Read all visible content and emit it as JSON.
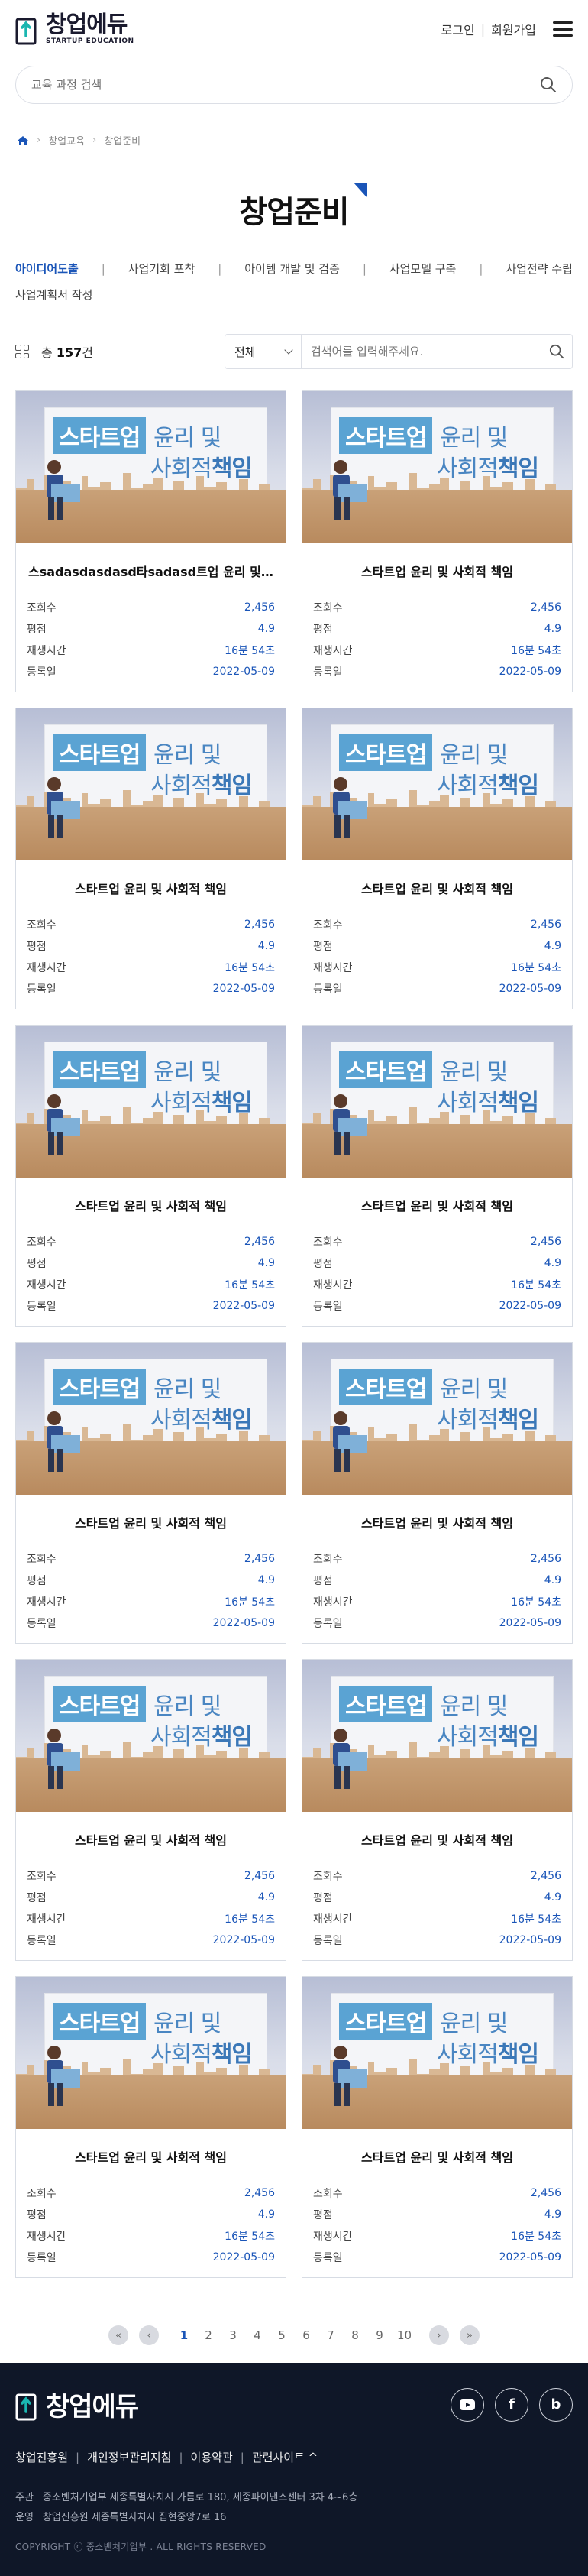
{
  "header": {
    "logo_title": "창업에듀",
    "logo_sub": "STARTUP EDUCATION",
    "login": "로그인",
    "signup": "회원가입"
  },
  "search": {
    "placeholder": "교육 과정 검색"
  },
  "breadcrumb": [
    "창업교육",
    "창업준비"
  ],
  "page_title": "창업준비",
  "categories": [
    "아이디어도출",
    "사업기회 포착",
    "아이템 개발 및 검증",
    "사업모델 구축",
    "사업전략 수립",
    "사업계획서 작성"
  ],
  "active_category": "아이디어도출",
  "filter": {
    "total_prefix": "총",
    "total_count": "157",
    "total_suffix": "건",
    "select_value": "전체",
    "input_placeholder": "검색어를 입력해주세요."
  },
  "meta_labels": {
    "views": "조회수",
    "rating": "평점",
    "duration": "재생시간",
    "date": "등록일"
  },
  "thumb_text": {
    "line1": "스타트업",
    "line2": "윤리 및",
    "line3a": "사회적",
    "line3b": "책임"
  },
  "cards": [
    {
      "title": "스sadasdasdasd타sadasd트업 윤리 및 사회적 책임",
      "views": "2,456",
      "rating": "4.9",
      "duration": "16분 54초",
      "date": "2022-05-09"
    },
    {
      "title": "스타트업 윤리 및 사회적 책임",
      "views": "2,456",
      "rating": "4.9",
      "duration": "16분 54초",
      "date": "2022-05-09"
    },
    {
      "title": "스타트업 윤리 및 사회적 책임",
      "views": "2,456",
      "rating": "4.9",
      "duration": "16분 54초",
      "date": "2022-05-09"
    },
    {
      "title": "스타트업 윤리 및 사회적 책임",
      "views": "2,456",
      "rating": "4.9",
      "duration": "16분 54초",
      "date": "2022-05-09"
    },
    {
      "title": "스타트업 윤리 및 사회적 책임",
      "views": "2,456",
      "rating": "4.9",
      "duration": "16분 54초",
      "date": "2022-05-09"
    },
    {
      "title": "스타트업 윤리 및 사회적 책임",
      "views": "2,456",
      "rating": "4.9",
      "duration": "16분 54초",
      "date": "2022-05-09"
    },
    {
      "title": "스타트업 윤리 및 사회적 책임",
      "views": "2,456",
      "rating": "4.9",
      "duration": "16분 54초",
      "date": "2022-05-09"
    },
    {
      "title": "스타트업 윤리 및 사회적 책임",
      "views": "2,456",
      "rating": "4.9",
      "duration": "16분 54초",
      "date": "2022-05-09"
    },
    {
      "title": "스타트업 윤리 및 사회적 책임",
      "views": "2,456",
      "rating": "4.9",
      "duration": "16분 54초",
      "date": "2022-05-09"
    },
    {
      "title": "스타트업 윤리 및 사회적 책임",
      "views": "2,456",
      "rating": "4.9",
      "duration": "16분 54초",
      "date": "2022-05-09"
    },
    {
      "title": "스타트업 윤리 및 사회적 책임",
      "views": "2,456",
      "rating": "4.9",
      "duration": "16분 54초",
      "date": "2022-05-09"
    },
    {
      "title": "스타트업 윤리 및 사회적 책임",
      "views": "2,456",
      "rating": "4.9",
      "duration": "16분 54초",
      "date": "2022-05-09"
    }
  ],
  "pagination": {
    "pages": [
      "1",
      "2",
      "3",
      "4",
      "5",
      "6",
      "7",
      "8",
      "9",
      "10"
    ],
    "current": "1"
  },
  "footer": {
    "logo_title": "창업에듀",
    "links": [
      "창업진흥원",
      "개인정보관리지침",
      "이용약관",
      "관련사이트 ^"
    ],
    "host_label": "주관",
    "host_value": "중소벤처기업부   세종특별자치시 가름로 180, 세종파이낸스센터 3차 4~6층",
    "operator_label": "운영",
    "operator_value": "창업진흥원   세종특별자치시 집현중앙7로 16",
    "copyright": "COPYRIGHT ⓒ 중소벤처기업부 . ALL RIGHTS RESERVED"
  },
  "colors": {
    "accent": "#1a55b8",
    "footer_bg": "#0f1728",
    "logo_teal": "#1ab6b0"
  },
  "icons": [
    "logo-icon",
    "hamburger-icon",
    "search-icon",
    "home-icon",
    "grid-view-icon",
    "chevron-down-icon",
    "youtube-icon",
    "facebook-icon",
    "blog-icon"
  ]
}
